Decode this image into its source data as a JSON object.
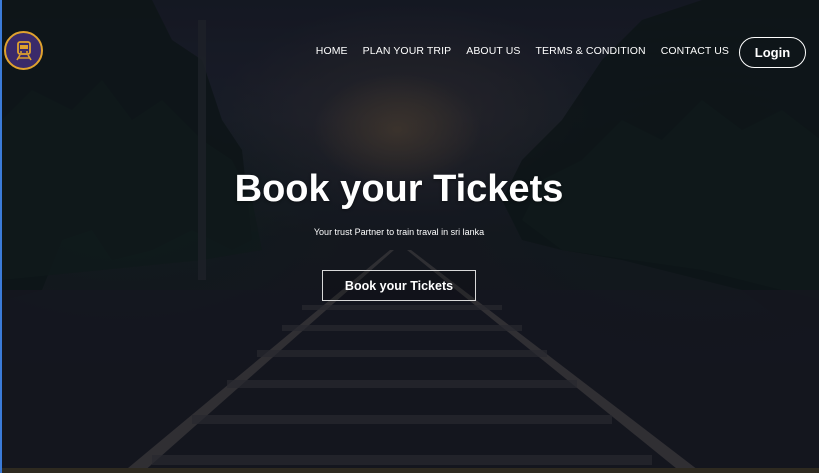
{
  "header": {
    "logo_icon": "train-icon",
    "nav": [
      {
        "label": "HOME"
      },
      {
        "label": "PLAN YOUR TRIP"
      },
      {
        "label": "ABOUT US"
      },
      {
        "label": "TERMS & CONDITION"
      },
      {
        "label": "CONTACT US"
      }
    ],
    "login_label": "Login"
  },
  "hero": {
    "title": "Book your Tickets",
    "subtitle": "Your trust Partner to train traval in sri lanka",
    "cta_label": "Book your Tickets"
  },
  "colors": {
    "logo_ring": "#e0a22e",
    "logo_fill": "#3a2a6a",
    "text": "#ffffff"
  }
}
